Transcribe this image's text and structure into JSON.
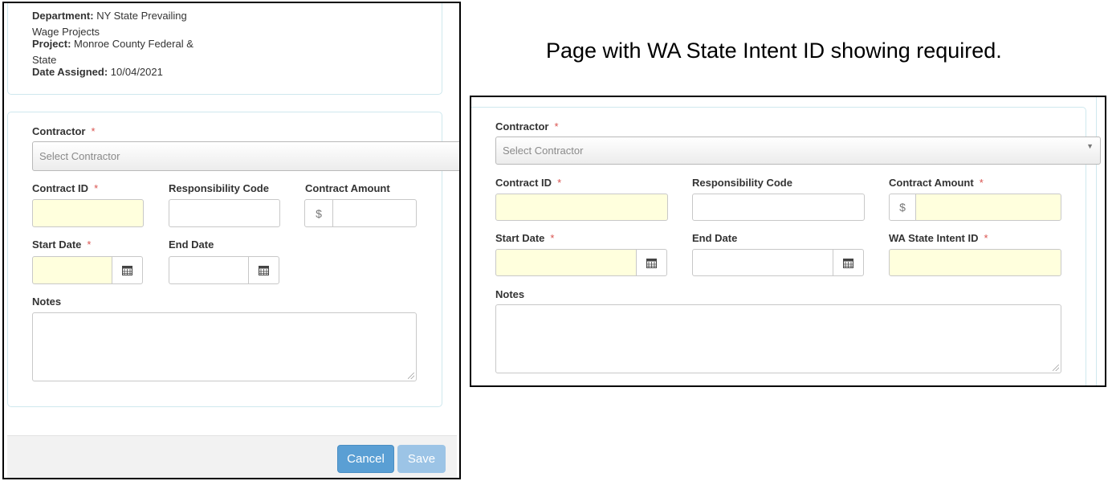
{
  "caption": "Page with WA State Intent ID showing required.",
  "left_form": {
    "info": {
      "department_label": "Department:",
      "department_value_1": "NY State Prevailing",
      "department_value_2": "Wage Projects",
      "project_label": "Project:",
      "project_value_1": "Monroe County Federal &",
      "project_value_2": "State",
      "date_assigned_label": "Date Assigned:",
      "date_assigned_value": "10/04/2021"
    },
    "contractor_label": "Contractor",
    "contractor_placeholder": "Select Contractor",
    "contract_id_label": "Contract ID",
    "responsibility_code_label": "Responsibility Code",
    "contract_amount_label": "Contract Amount",
    "currency_symbol": "$",
    "start_date_label": "Start Date",
    "end_date_label": "End Date",
    "notes_label": "Notes",
    "required_mark": "*",
    "cancel_label": "Cancel",
    "save_label": "Save"
  },
  "right_form": {
    "contractor_label": "Contractor",
    "contractor_placeholder": "Select Contractor",
    "contract_id_label": "Contract ID",
    "responsibility_code_label": "Responsibility Code",
    "contract_amount_label": "Contract Amount",
    "currency_symbol": "$",
    "start_date_label": "Start Date",
    "end_date_label": "End Date",
    "wa_state_intent_id_label": "WA State Intent ID",
    "notes_label": "Notes",
    "required_mark": "*"
  },
  "colors": {
    "required_field_bg": "#ffffdd",
    "required_asterisk": "#d9534f",
    "cancel_button": "#5a9fd4",
    "save_button_disabled": "#9cc4e6"
  }
}
